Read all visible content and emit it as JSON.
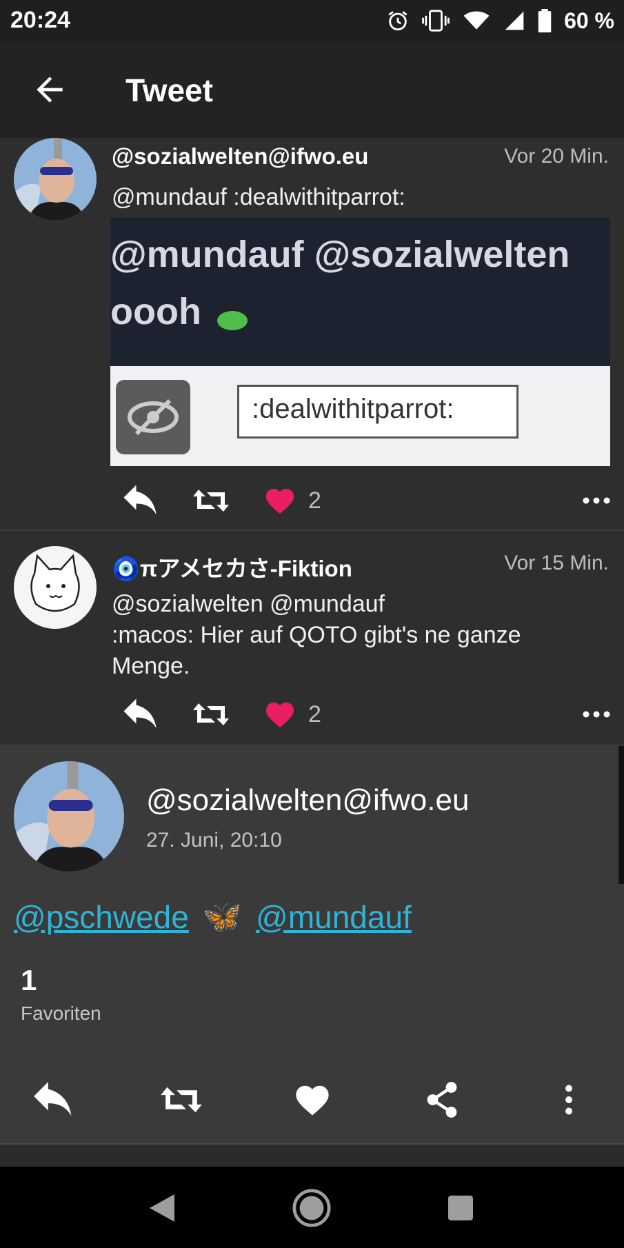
{
  "status_bar": {
    "time": "20:24",
    "battery": "60 %"
  },
  "app_bar": {
    "title": "Tweet"
  },
  "timeline": [
    {
      "handle": "@sozialwelten@ifwo.eu",
      "time_ago": "Vor 20 Min.",
      "content": "@mundauf :dealwithitparrot:",
      "media": {
        "line1": "@mundauf @sozialwelten",
        "line2": "oooh",
        "label": ":dealwithitparrot:"
      },
      "favourites": "2"
    },
    {
      "handle": "🧿πアメセカさ-Fiktion",
      "time_ago": "Vor 15 Min.",
      "content_line1": "@sozialwelten @mundauf",
      "content_line2": ":macos: Hier auf QOTO gibt's ne ganze",
      "content_line3": "Menge.",
      "favourites": "2"
    }
  ],
  "detail": {
    "handle": "@sozialwelten@ifwo.eu",
    "date": "27. Juni, 20:10",
    "mention1": "@pschwede",
    "emoji": "🦋",
    "mention2": "@mundauf",
    "favourites_count": "1",
    "favourites_label": "Favoriten"
  },
  "colors": {
    "accent": "#2fb3d6",
    "heart": "#e91e63",
    "background": "#2e2e2e"
  },
  "icons": [
    "back-arrow-icon",
    "reply-icon",
    "boost-icon",
    "heart-icon",
    "more-icon",
    "share-icon",
    "more-vertical-icon",
    "alarm-icon",
    "vibrate-icon",
    "wifi-icon",
    "signal-icon",
    "battery-icon"
  ]
}
